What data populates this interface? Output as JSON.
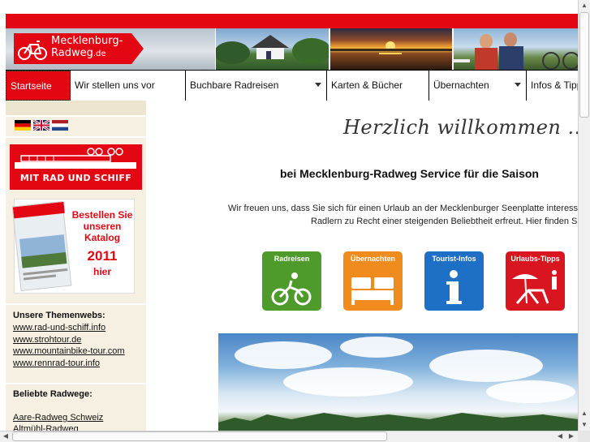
{
  "header": {
    "logo_line1": "Mecklenburg-",
    "logo_line2": "Radweg",
    "logo_tld": ".de"
  },
  "nav": {
    "items": [
      {
        "label": "Startseite",
        "active": true
      },
      {
        "label": "Wir stellen uns vor"
      },
      {
        "label": "Buchbare Radreisen",
        "dropdown": true
      },
      {
        "label": "Karten & Bücher"
      },
      {
        "label": "Übernachten",
        "dropdown": true
      },
      {
        "label": "Infos & Tipps"
      }
    ]
  },
  "sidebar": {
    "ship_banner": "MIT RAD UND SCHIFF",
    "katalog": {
      "line1": "Bestellen Sie",
      "line2": "unseren",
      "line3": "Katalog",
      "year": "2011",
      "line4": "hier"
    },
    "themenwebs_heading": "Unsere Themenwebs:",
    "themenwebs": [
      "www.rad-und-schiff.info",
      "www.strohtour.de",
      "www.mountainbike-tour.com",
      "www.rennrad-tour.info"
    ],
    "radwege_heading": "Beliebte Radwege:",
    "radwege": [
      "Aare-Radweg Schweiz",
      "Altmühl-Radweg"
    ]
  },
  "main": {
    "welcome": "Herzlich willkommen ...",
    "title": "bei Mecklenburg-Radweg Service für die Saison",
    "intro_line1": "Wir freuen uns, dass Sie sich für einen Urlaub an der Mecklenburger Seenplatte interess",
    "intro_line2": "Radlern zu Recht einer steigenden Beliebtheit erfreut. Hier finden S",
    "tiles": [
      {
        "label": "Radreisen",
        "color": "#4e9a2a"
      },
      {
        "label": "Übernachten",
        "color": "#f08c1e"
      },
      {
        "label": "Tourist-Infos",
        "color": "#1e6fc6"
      },
      {
        "label": "Urlaubs-Tipps",
        "color": "#d9161f"
      }
    ]
  },
  "colors": {
    "brand_red": "#e30613",
    "sidebar_bg": "#f5f0e1"
  }
}
